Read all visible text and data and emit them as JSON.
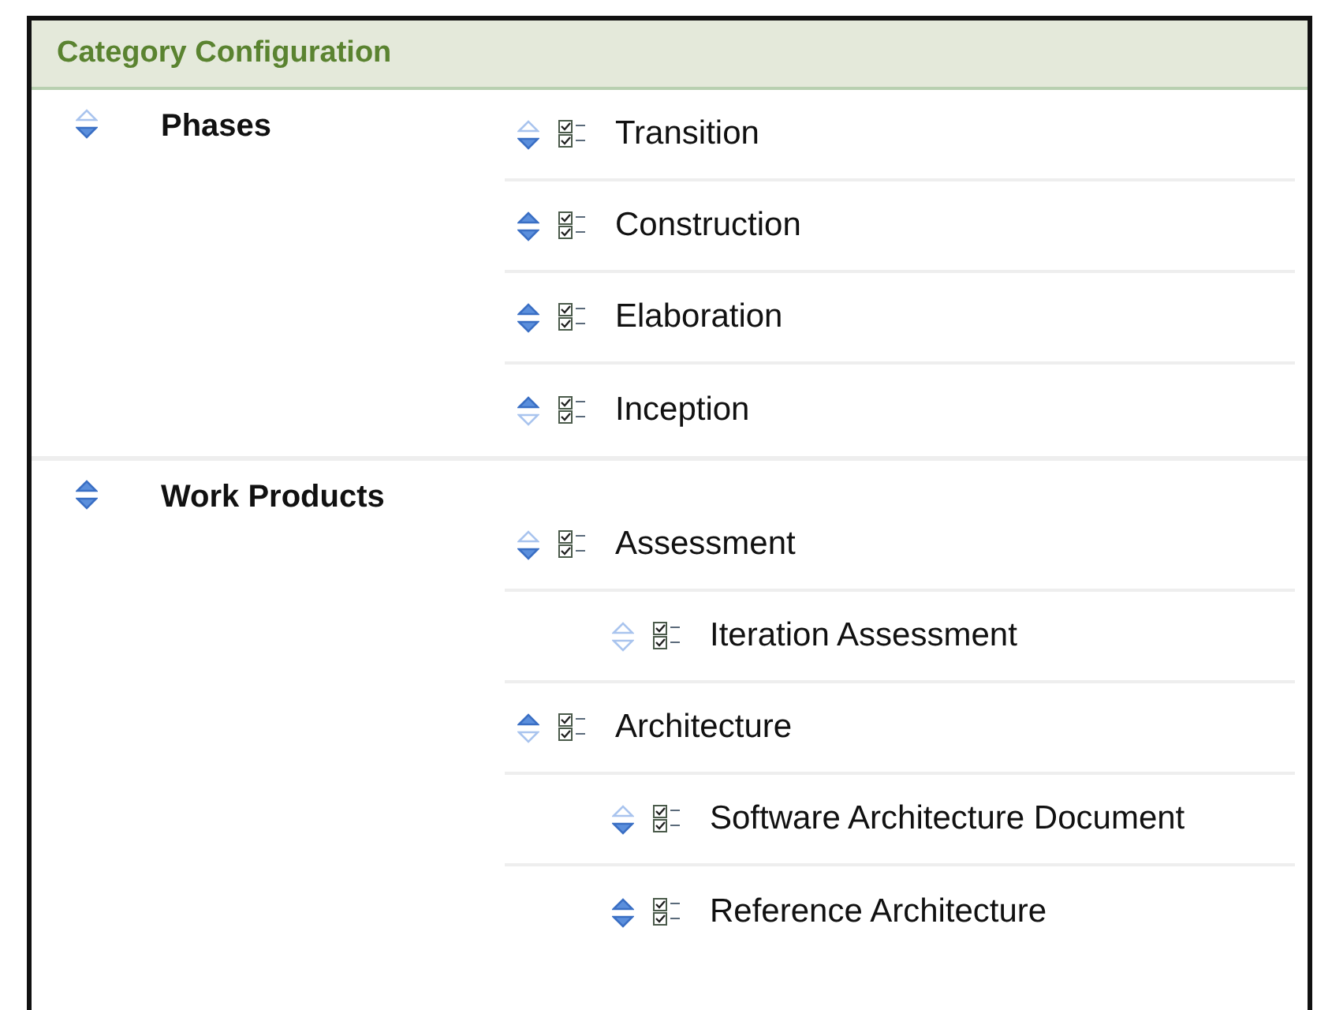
{
  "panel": {
    "title": "Category Configuration"
  },
  "categories": [
    {
      "name": "Phases",
      "up_enabled": false,
      "down_enabled": true,
      "items": [
        {
          "name": "Transition",
          "up_enabled": false,
          "down_enabled": true
        },
        {
          "name": "Construction",
          "up_enabled": true,
          "down_enabled": true
        },
        {
          "name": "Elaboration",
          "up_enabled": true,
          "down_enabled": true
        },
        {
          "name": "Inception",
          "up_enabled": true,
          "down_enabled": false
        }
      ]
    },
    {
      "name": "Work Products",
      "up_enabled": true,
      "down_enabled": true,
      "items": [
        {
          "name": "Assessment",
          "up_enabled": false,
          "down_enabled": true,
          "children": [
            {
              "name": "Iteration Assessment",
              "up_enabled": false,
              "down_enabled": false
            }
          ]
        },
        {
          "name": "Architecture",
          "up_enabled": true,
          "down_enabled": false,
          "children": [
            {
              "name": "Software Architecture Document",
              "up_enabled": false,
              "down_enabled": true
            },
            {
              "name": "Reference Architecture",
              "up_enabled": true,
              "down_enabled": true
            }
          ]
        }
      ]
    }
  ]
}
